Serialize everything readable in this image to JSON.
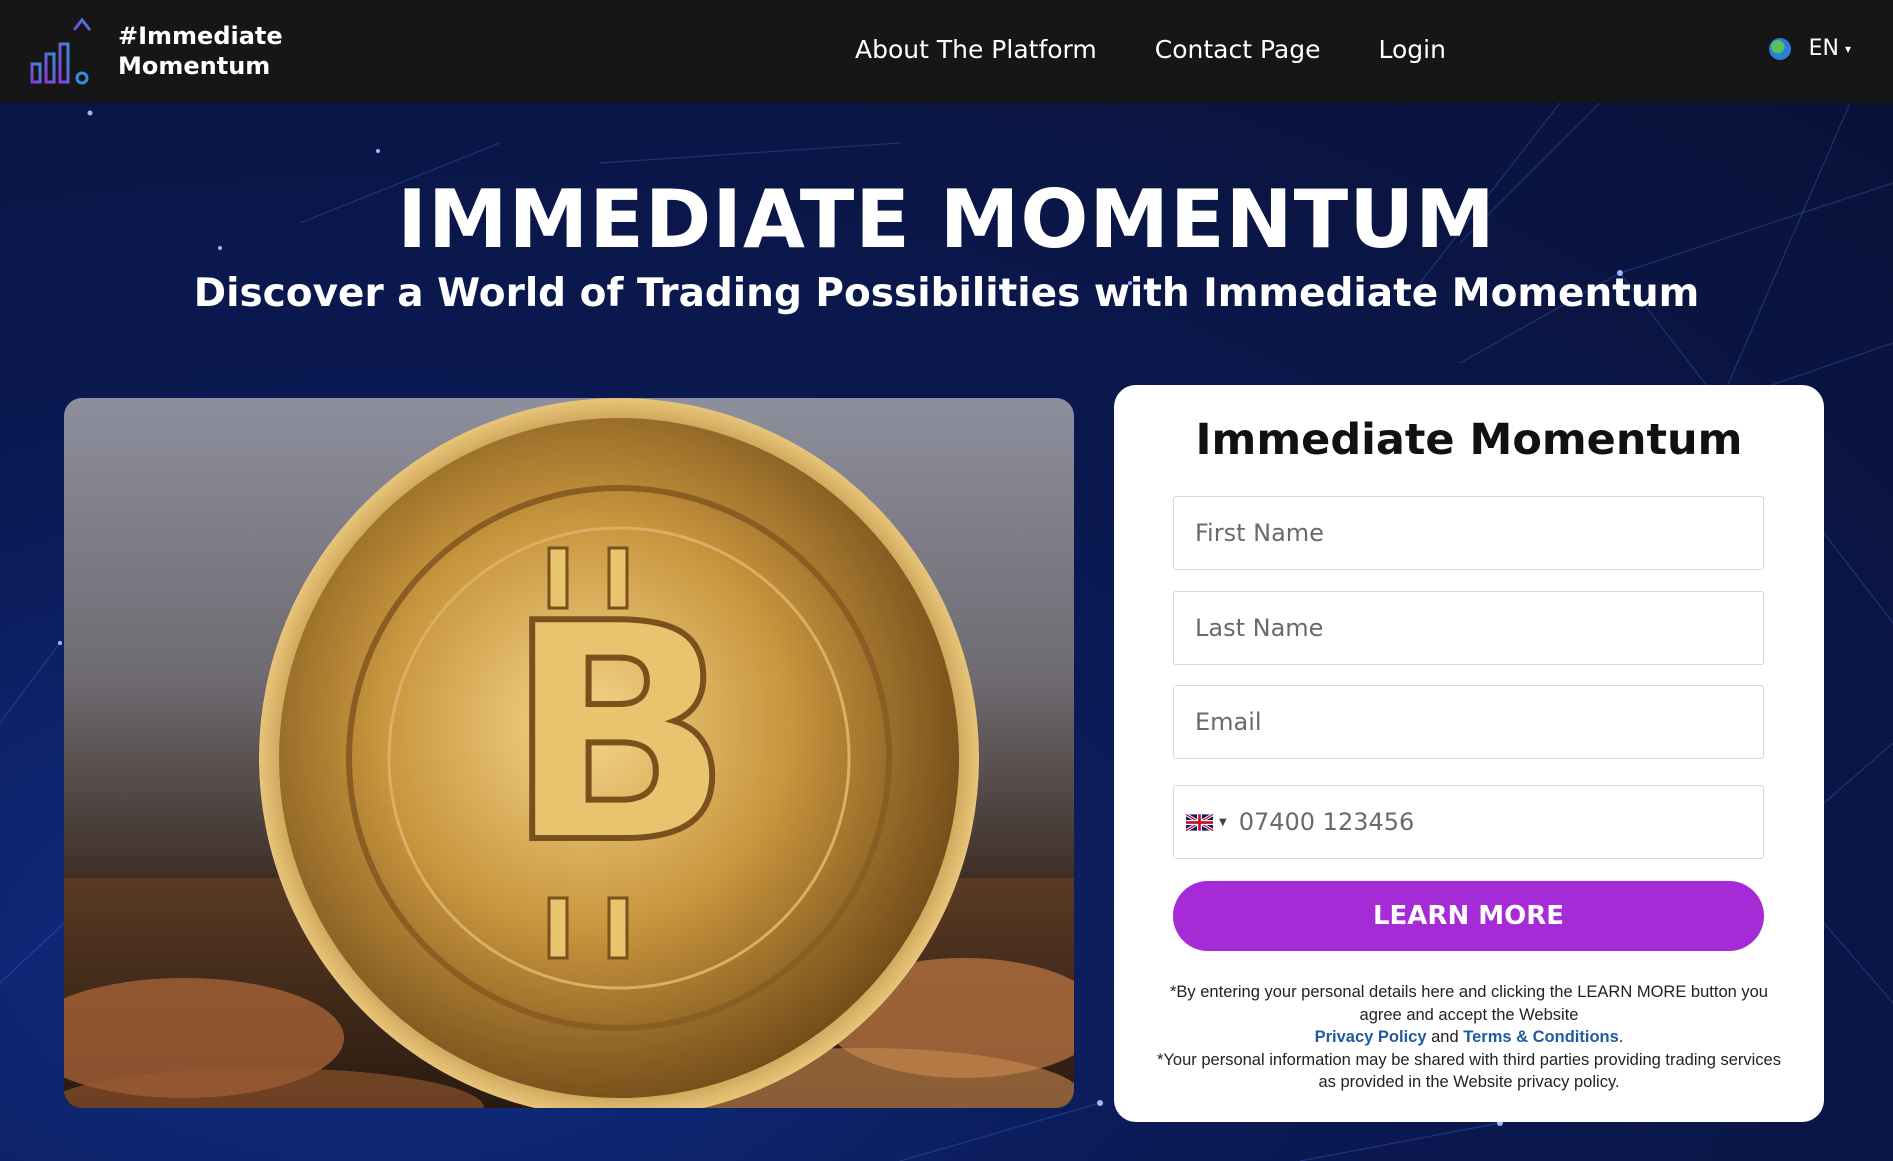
{
  "header": {
    "logo_line1": "#Immediate",
    "logo_line2": "Momentum",
    "nav": [
      "About The Platform",
      "Contact Page",
      "Login"
    ],
    "language": "EN"
  },
  "hero": {
    "title": "IMMEDIATE MOMENTUM",
    "subtitle": "Discover a World of Trading Possibilities with Immediate Momentum"
  },
  "form": {
    "title": "Immediate Momentum",
    "first_name_placeholder": "First Name",
    "last_name_placeholder": "Last Name",
    "email_placeholder": "Email",
    "phone_placeholder": "07400 123456",
    "submit_label": "LEARN MORE",
    "disclaimer_part1": "*By entering your personal details here and clicking the LEARN MORE button you agree and accept the Website",
    "privacy_link": "Privacy Policy",
    "and_text": "and",
    "terms_link": "Terms & Conditions",
    "period": ".",
    "disclaimer_part2": "*Your personal information may be shared with third parties providing trading services as provided in the Website privacy policy."
  },
  "colors": {
    "header_bg": "#161616",
    "accent": "#a52bd6",
    "link": "#1f5b9e"
  }
}
